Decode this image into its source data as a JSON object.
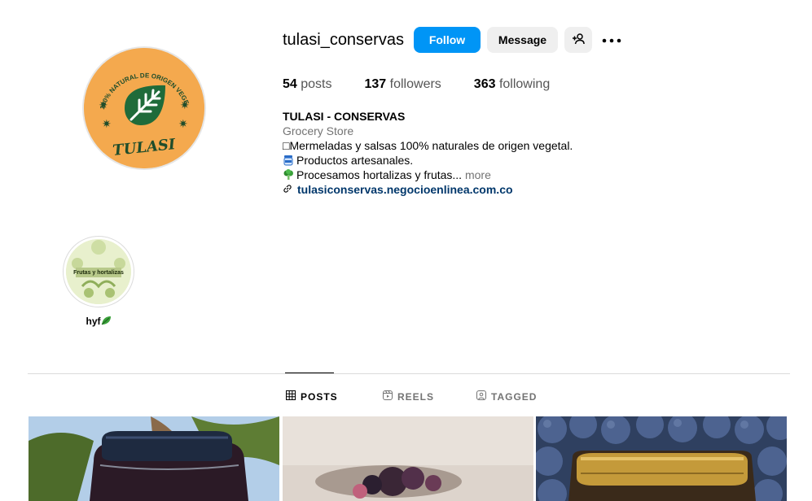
{
  "profile": {
    "username": "tulasi_conservas",
    "avatar_text_top": "100% NATURAL DE ORIGEN VEGETAL",
    "avatar_text_bottom": "TULASI"
  },
  "actions": {
    "follow_label": "Follow",
    "message_label": "Message",
    "add_user_icon": "person-add-icon",
    "more_icon": "more-options-icon"
  },
  "stats": {
    "posts_count": "54",
    "posts_label": "posts",
    "followers_count": "137",
    "followers_label": "followers",
    "following_count": "363",
    "following_label": "following"
  },
  "bio": {
    "name": "TULASI - CONSERVAS",
    "category": "Grocery Store",
    "line1": "□Mermeladas y salsas 100% naturales de origen vegetal.",
    "line2": "Productos artesanales.",
    "line3": "Procesamos hortalizas y frutas...",
    "more_label": "more",
    "link": "tulasiconservas.negocioenlinea.com.co"
  },
  "highlights": [
    {
      "title": "hyf",
      "cover_text": "Frutas y hortalizas"
    }
  ],
  "tabs": [
    {
      "label": "POSTS",
      "icon": "grid-icon",
      "active": true
    },
    {
      "label": "REELS",
      "icon": "reels-icon",
      "active": false
    },
    {
      "label": "TAGGED",
      "icon": "tagged-icon",
      "active": false
    }
  ],
  "colors": {
    "primary_button": "#0095f6",
    "secondary_button": "#efefef",
    "link": "#00376b",
    "muted_text": "#737373",
    "avatar_bg": "#f4a94e",
    "avatar_leaf": "#1f6b3a"
  }
}
